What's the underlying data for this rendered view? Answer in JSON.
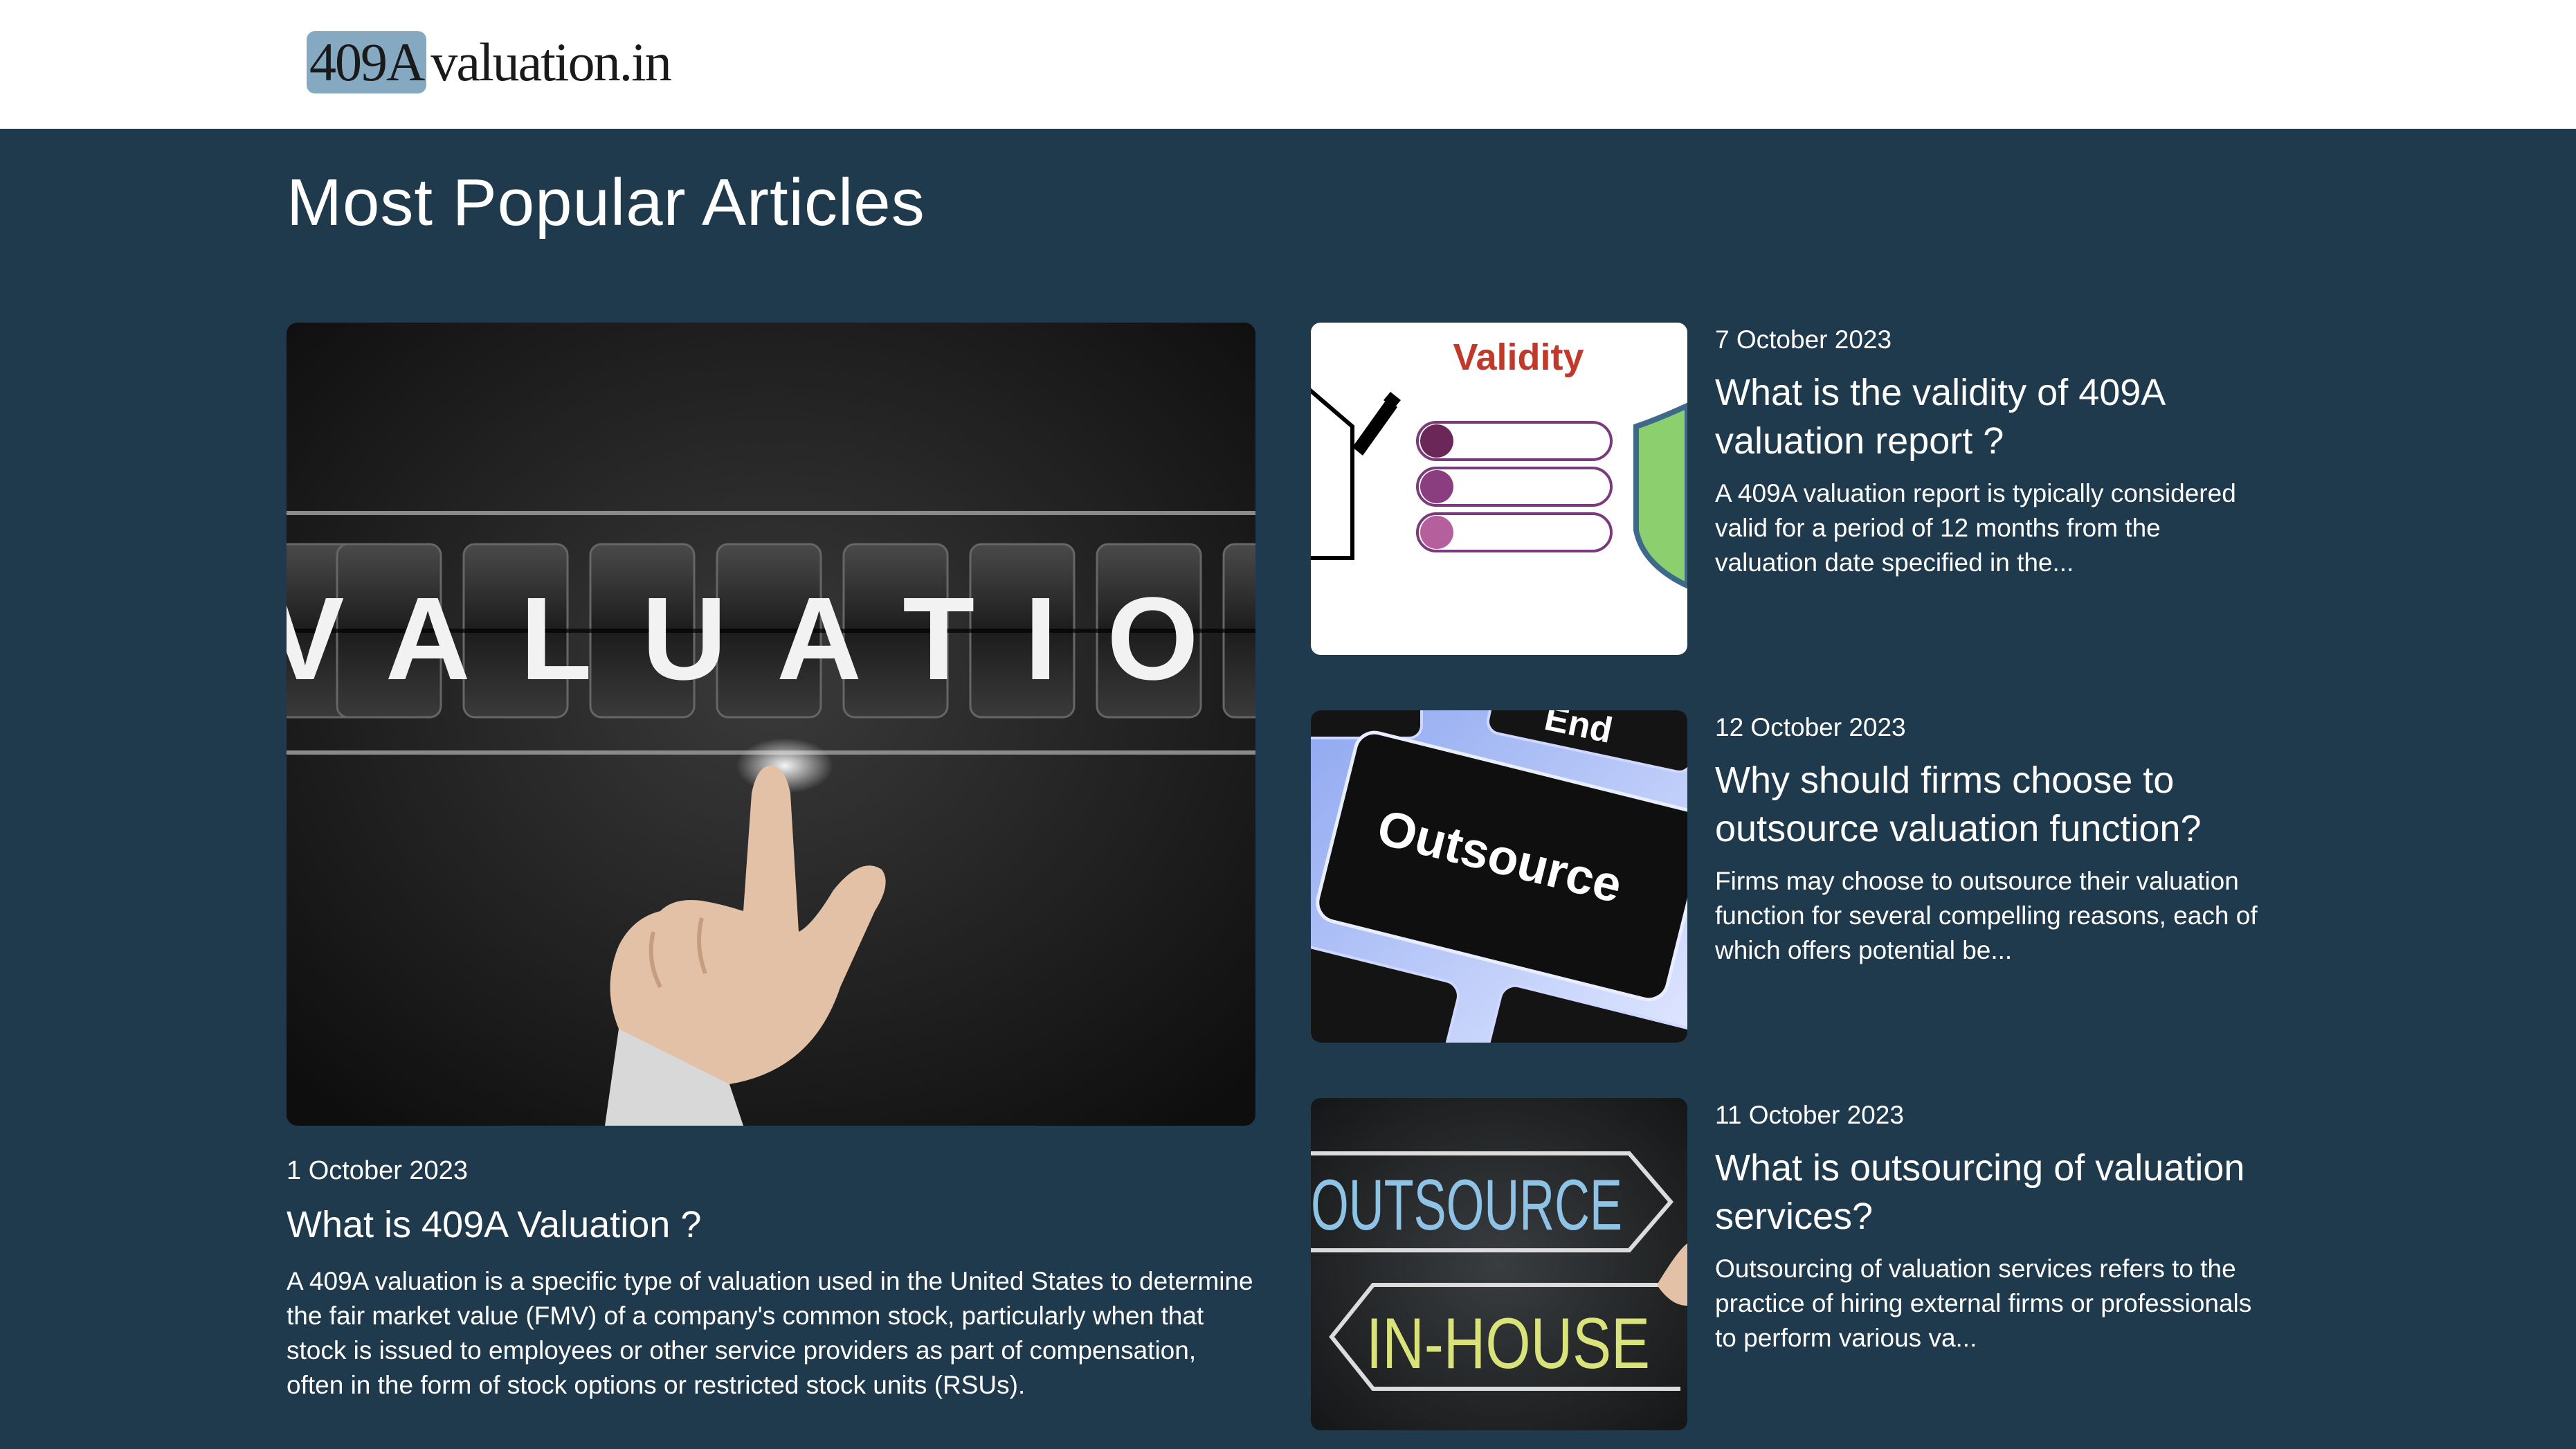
{
  "header": {
    "logo_highlight": "409A",
    "logo_rest": "valuation.in"
  },
  "section": {
    "title": "Most Popular Articles"
  },
  "featured": {
    "image_text": "VALUATION",
    "date": "1 October 2023",
    "title": "What is 409A Valuation ?",
    "excerpt": "A 409A valuation is a specific type of valuation used in the United States to determine the fair market value (FMV) of a company's common stock, particularly when that stock is issued to employees or other service providers as part of compensation, often in the form of stock options or restricted stock units (RSUs)."
  },
  "articles": [
    {
      "image_text": "Validity",
      "date": "7 October 2023",
      "title": "What is the validity of 409A valuation report ?",
      "excerpt": "A 409A valuation report is typically considered valid for a period of 12 months from the valuation date specified in the..."
    },
    {
      "image_text": "Outsource",
      "image_key_top": "End",
      "date": "12 October 2023",
      "title": "Why should firms choose to outsource valuation function?",
      "excerpt": "Firms may choose to outsource their valuation function for several compelling reasons, each of which offers potential be..."
    },
    {
      "image_text_top": "OUTSOURCE",
      "image_text_bottom": "IN-HOUSE",
      "date": "11 October 2023",
      "title": "What is outsourcing of valuation services?",
      "excerpt": "Outsourcing of valuation services refers to the practice of hiring external firms or professionals to perform various va..."
    }
  ],
  "colors": {
    "background": "#1f3a4d",
    "header_bg": "#ffffff",
    "logo_highlight": "#86a9c2",
    "validity_red": "#c0392b"
  }
}
